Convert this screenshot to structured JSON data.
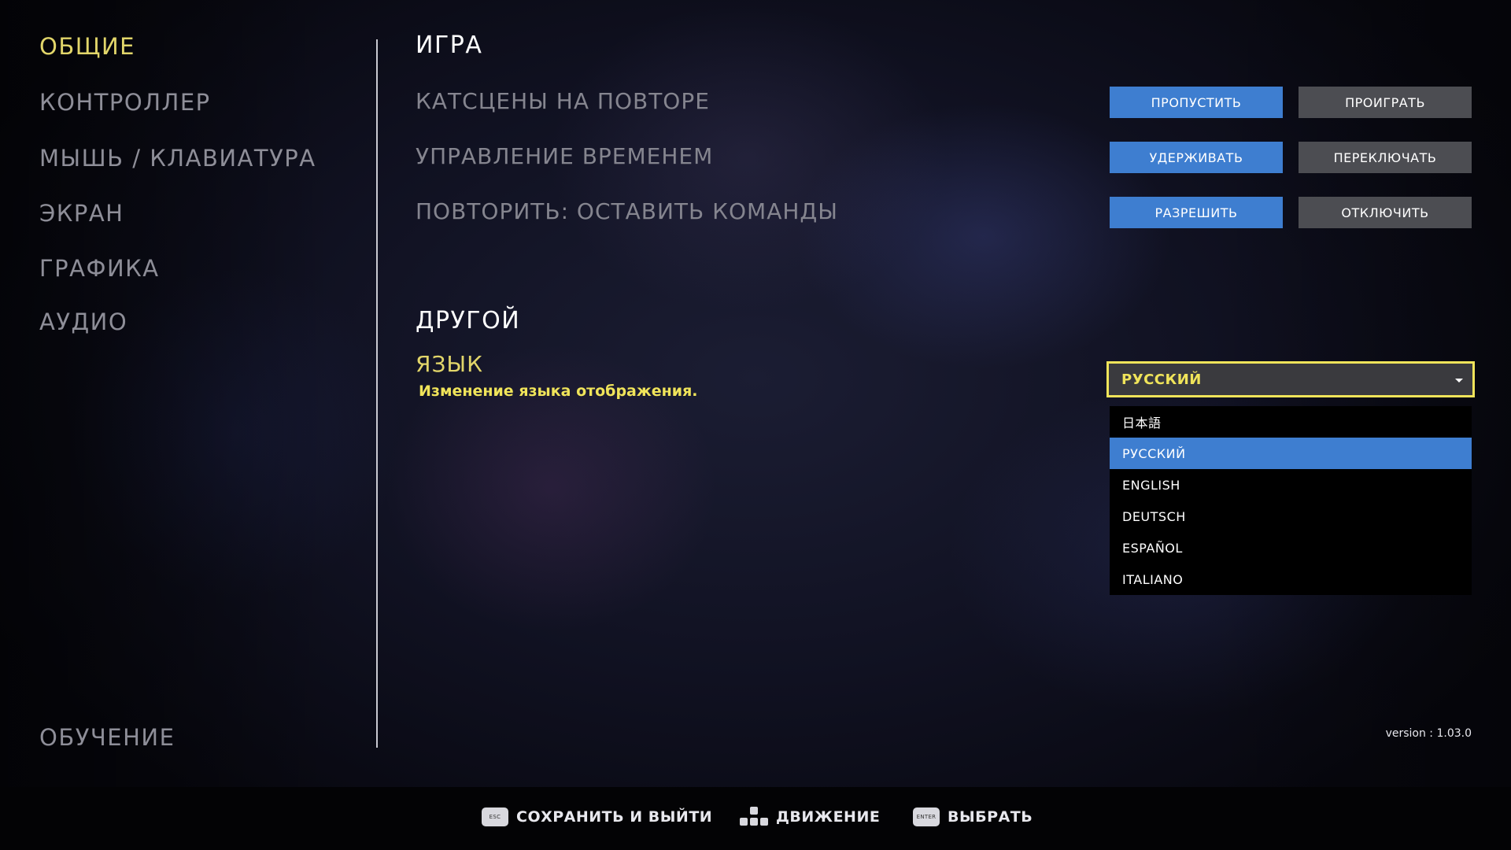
{
  "nav": {
    "items": [
      {
        "label": "ОБЩИЕ",
        "active": true
      },
      {
        "label": "КОНТРОЛЛЕР",
        "active": false
      },
      {
        "label": "МЫШЬ / КЛАВИАТУРА",
        "active": false
      },
      {
        "label": "ЭКРАН",
        "active": false
      },
      {
        "label": "ГРАФИКА",
        "active": false
      },
      {
        "label": "АУДИО",
        "active": false
      }
    ],
    "tutorial": "ОБУЧЕНИЕ"
  },
  "game": {
    "title": "ИГРА",
    "settings": [
      {
        "label": "КАТСЦЕНЫ НА ПОВТОРЕ",
        "options": [
          "ПРОПУСТИТЬ",
          "ПРОИГРАТЬ"
        ],
        "selected": "ПРОПУСТИТЬ"
      },
      {
        "label": "УПРАВЛЕНИЕ ВРЕМЕНЕМ",
        "options": [
          "УДЕРЖИВАТЬ",
          "ПЕРЕКЛЮЧАТЬ"
        ],
        "selected": "УДЕРЖИВАТЬ"
      },
      {
        "label": "ПОВТОРИТЬ: ОСТАВИТЬ КОМАНДЫ",
        "options": [
          "РАЗРЕШИТЬ",
          "ОТКЛЮЧИТЬ"
        ],
        "selected": "РАЗРЕШИТЬ"
      }
    ]
  },
  "other": {
    "title": "ДРУГОЙ",
    "language": {
      "label": "ЯЗЫК",
      "description": "Изменение языка отображения.",
      "current": "РУССКИЙ",
      "options": [
        "日本語",
        "РУССКИЙ",
        "ENGLISH",
        "DEUTSCH",
        "ESPAÑOL",
        "ITALIANO"
      ],
      "highlighted": "РУССКИЙ"
    }
  },
  "version": "version : 1.03.0",
  "footer": {
    "hints": [
      {
        "key": "ESC",
        "icon": "esc-key-icon",
        "label": "СОХРАНИТЬ И ВЫЙТИ"
      },
      {
        "key": "",
        "icon": "dpad-keys-icon",
        "label": "ДВИЖЕНИЕ"
      },
      {
        "key": "ENTER",
        "icon": "enter-key-icon",
        "label": "ВЫБРАТЬ"
      }
    ]
  },
  "colors": {
    "accent_yellow": "#e2d66a",
    "button_blue": "#3e7ed0",
    "button_gray": "#4c4d52",
    "muted_text": "#8e8e98"
  }
}
